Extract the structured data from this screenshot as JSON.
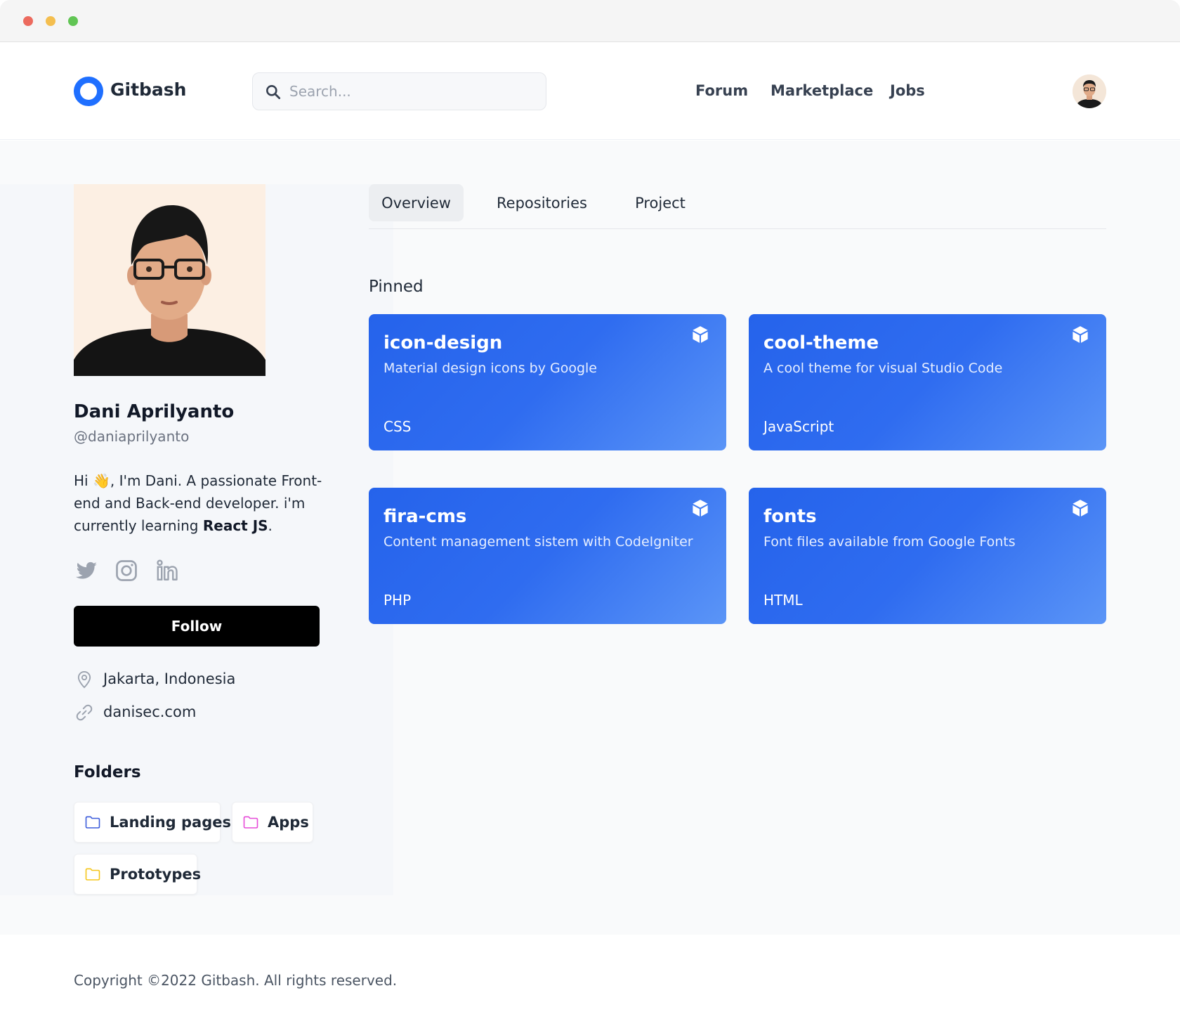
{
  "window": {
    "controls": [
      "close",
      "minimize",
      "maximize"
    ]
  },
  "header": {
    "logo": "Gitbash",
    "search": {
      "placeholder": "Search...",
      "value": "",
      "icon": "search-icon"
    },
    "nav": [
      "Forum",
      "Marketplace",
      "Jobs"
    ],
    "avatar": "user-avatar"
  },
  "profile": {
    "name": "Dani Aprilyanto",
    "handle": "@daniaprilyanto",
    "bio_prefix": "Hi ",
    "bio_emoji": "👋",
    "bio_main": ", I'm Dani. A passionate Front-end and Back-end developer. i'm currently learning ",
    "bio_bold": "React JS",
    "bio_suffix": ".",
    "social": [
      "twitter-icon",
      "instagram-icon",
      "linkedin-icon"
    ],
    "follow_label": "Follow",
    "location": "Jakarta, Indonesia",
    "website": "danisec.com"
  },
  "folders": {
    "heading": "Folders",
    "items": [
      {
        "label": "Landing pages",
        "color": "#3b5bdb"
      },
      {
        "label": "Apps",
        "color": "#e64bd8"
      },
      {
        "label": "Prototypes",
        "color": "#f5c518"
      }
    ]
  },
  "tabs": [
    {
      "label": "Overview",
      "active": true
    },
    {
      "label": "Repositories",
      "active": false
    },
    {
      "label": "Project",
      "active": false
    }
  ],
  "pinned": {
    "heading": "Pinned",
    "repos": [
      {
        "name": "icon-design",
        "description": "Material design icons by Google",
        "language": "CSS"
      },
      {
        "name": "cool-theme",
        "description": "A cool theme for visual Studio Code",
        "language": "JavaScript"
      },
      {
        "name": "fira-cms",
        "description": "Content management sistem with CodeIgniter",
        "language": "PHP"
      },
      {
        "name": "fonts",
        "description": "Font files available from Google Fonts",
        "language": "HTML"
      }
    ]
  },
  "footer": {
    "copyright": "Copyright ©2022 Gitbash. All rights reserved."
  },
  "colors": {
    "accent": "#1f6fff",
    "card": "#2563eb",
    "follow": "#000000"
  }
}
